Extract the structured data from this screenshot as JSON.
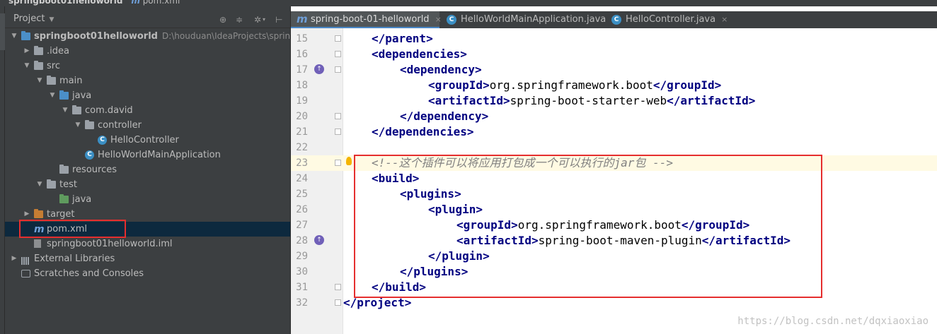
{
  "breadcrumb": {
    "project": "springboot01helloworld",
    "file": "pom.xml",
    "file_prefix": "m"
  },
  "project_panel": {
    "title": "Project",
    "tree": [
      {
        "label": "springboot01helloworld",
        "path": "D:\\houduan\\IdeaProjects\\springboo",
        "icon": "module-folder-icon",
        "depth": 0,
        "arrow": "open",
        "bold": true
      },
      {
        "label": ".idea",
        "icon": "folder-icon",
        "depth": 1,
        "arrow": "closed"
      },
      {
        "label": "src",
        "icon": "folder-icon",
        "depth": 1,
        "arrow": "open"
      },
      {
        "label": "main",
        "icon": "folder-icon",
        "depth": 2,
        "arrow": "open"
      },
      {
        "label": "java",
        "icon": "source-folder-icon",
        "depth": 3,
        "arrow": "open"
      },
      {
        "label": "com.david",
        "icon": "package-icon",
        "depth": 4,
        "arrow": "open"
      },
      {
        "label": "controller",
        "icon": "package-icon",
        "depth": 5,
        "arrow": "open"
      },
      {
        "label": "HelloController",
        "icon": "class-icon",
        "depth": 6,
        "arrow": "none"
      },
      {
        "label": "HelloWorldMainApplication",
        "icon": "spring-class-icon",
        "depth": 5,
        "arrow": "none"
      },
      {
        "label": "resources",
        "icon": "resources-folder-icon",
        "depth": 3,
        "arrow": "none"
      },
      {
        "label": "test",
        "icon": "folder-icon",
        "depth": 2,
        "arrow": "open"
      },
      {
        "label": "java",
        "icon": "test-folder-icon",
        "depth": 3,
        "arrow": "none"
      },
      {
        "label": "target",
        "icon": "excluded-folder-icon",
        "depth": 1,
        "arrow": "closed"
      },
      {
        "label": "pom.xml",
        "icon": "maven-icon",
        "depth": 1,
        "arrow": "none",
        "selected": true
      },
      {
        "label": "springboot01helloworld.iml",
        "icon": "iml-file-icon",
        "depth": 1,
        "arrow": "none"
      },
      {
        "label": "External Libraries",
        "icon": "library-icon",
        "depth": 0,
        "arrow": "closed"
      },
      {
        "label": "Scratches and Consoles",
        "icon": "scratches-icon",
        "depth": 0,
        "arrow": "none"
      }
    ]
  },
  "editor": {
    "tabs": [
      {
        "label": "spring-boot-01-helloworld",
        "icon": "maven-icon",
        "active": true
      },
      {
        "label": "HelloWorldMainApplication.java",
        "icon": "spring-class-icon",
        "active": false
      },
      {
        "label": "HelloController.java",
        "icon": "class-icon",
        "active": false
      }
    ],
    "lines": [
      {
        "num": "15",
        "indent": 1,
        "tokens": [
          [
            "tag",
            "</parent>"
          ]
        ]
      },
      {
        "num": "16",
        "indent": 1,
        "tokens": [
          [
            "tag",
            "<dependencies>"
          ]
        ]
      },
      {
        "num": "17",
        "indent": 2,
        "tokens": [
          [
            "tag",
            "<dependency>"
          ]
        ],
        "gutter_icon": true
      },
      {
        "num": "18",
        "indent": 3,
        "tokens": [
          [
            "tag",
            "<groupId>"
          ],
          [
            "text",
            "org.springframework.boot"
          ],
          [
            "tag",
            "</groupId>"
          ]
        ]
      },
      {
        "num": "19",
        "indent": 3,
        "tokens": [
          [
            "tag",
            "<artifactId>"
          ],
          [
            "text",
            "spring-boot-starter-web"
          ],
          [
            "tag",
            "</artifactId>"
          ]
        ]
      },
      {
        "num": "20",
        "indent": 2,
        "tokens": [
          [
            "tag",
            "</dependency>"
          ]
        ]
      },
      {
        "num": "21",
        "indent": 1,
        "tokens": [
          [
            "tag",
            "</dependencies>"
          ]
        ]
      },
      {
        "num": "22",
        "indent": 0,
        "tokens": []
      },
      {
        "num": "23",
        "indent": 1,
        "tokens": [
          [
            "comment",
            "<!--这个插件可以将应用打包成一个可以执行的jar包 -->"
          ]
        ],
        "current": true
      },
      {
        "num": "24",
        "indent": 1,
        "tokens": [
          [
            "tag",
            "<build>"
          ]
        ]
      },
      {
        "num": "25",
        "indent": 2,
        "tokens": [
          [
            "tag",
            "<plugins>"
          ]
        ]
      },
      {
        "num": "26",
        "indent": 3,
        "tokens": [
          [
            "tag",
            "<plugin>"
          ]
        ]
      },
      {
        "num": "27",
        "indent": 4,
        "tokens": [
          [
            "tag",
            "<groupId>"
          ],
          [
            "text",
            "org.springframework.boot"
          ],
          [
            "tag",
            "</groupId>"
          ]
        ]
      },
      {
        "num": "28",
        "indent": 4,
        "tokens": [
          [
            "tag",
            "<artifactId>"
          ],
          [
            "text",
            "spring-boot-maven-plugin"
          ],
          [
            "tag",
            "</artifactId>"
          ]
        ],
        "gutter_icon": true
      },
      {
        "num": "29",
        "indent": 3,
        "tokens": [
          [
            "tag",
            "</plugin>"
          ]
        ]
      },
      {
        "num": "30",
        "indent": 2,
        "tokens": [
          [
            "tag",
            "</plugins>"
          ]
        ]
      },
      {
        "num": "31",
        "indent": 1,
        "tokens": [
          [
            "tag",
            "</build>"
          ]
        ]
      },
      {
        "num": "32",
        "indent": 0,
        "tokens": [
          [
            "tag",
            "</project>"
          ]
        ]
      }
    ],
    "watermark": "https://blog.csdn.net/dqxiaoxiao"
  },
  "colors": {
    "highlight_box": "#e52e2e",
    "tag": "#000080",
    "comment": "#808080",
    "selection": "#0d293e"
  }
}
